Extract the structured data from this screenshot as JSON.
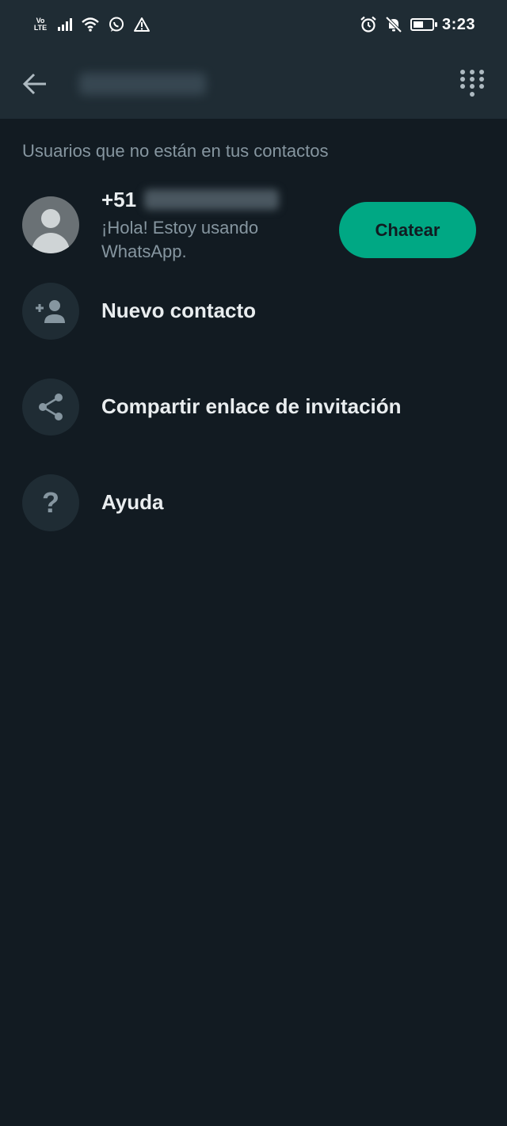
{
  "statusbar": {
    "volte_line1": "Vo",
    "volte_line2": "LTE",
    "time": "3:23"
  },
  "toolbar": {
    "back_icon": "arrow-left-icon",
    "dialpad_icon": "dialpad-icon"
  },
  "section": {
    "title": "Usuarios que no están en tus contactos"
  },
  "result": {
    "phone_prefix": "+51",
    "status": "¡Hola! Estoy usando WhatsApp.",
    "chat_label": "Chatear"
  },
  "actions": [
    {
      "label": "Nuevo contacto",
      "icon": "add-person-icon"
    },
    {
      "label": "Compartir enlace de invitación",
      "icon": "share-icon"
    },
    {
      "label": "Ayuda",
      "icon": "help-icon",
      "glyph": "?"
    }
  ],
  "colors": {
    "background": "#121b22",
    "header": "#1f2c34",
    "accent": "#00a884",
    "secondary_text": "#8696a0",
    "primary_text": "#e9edef"
  }
}
